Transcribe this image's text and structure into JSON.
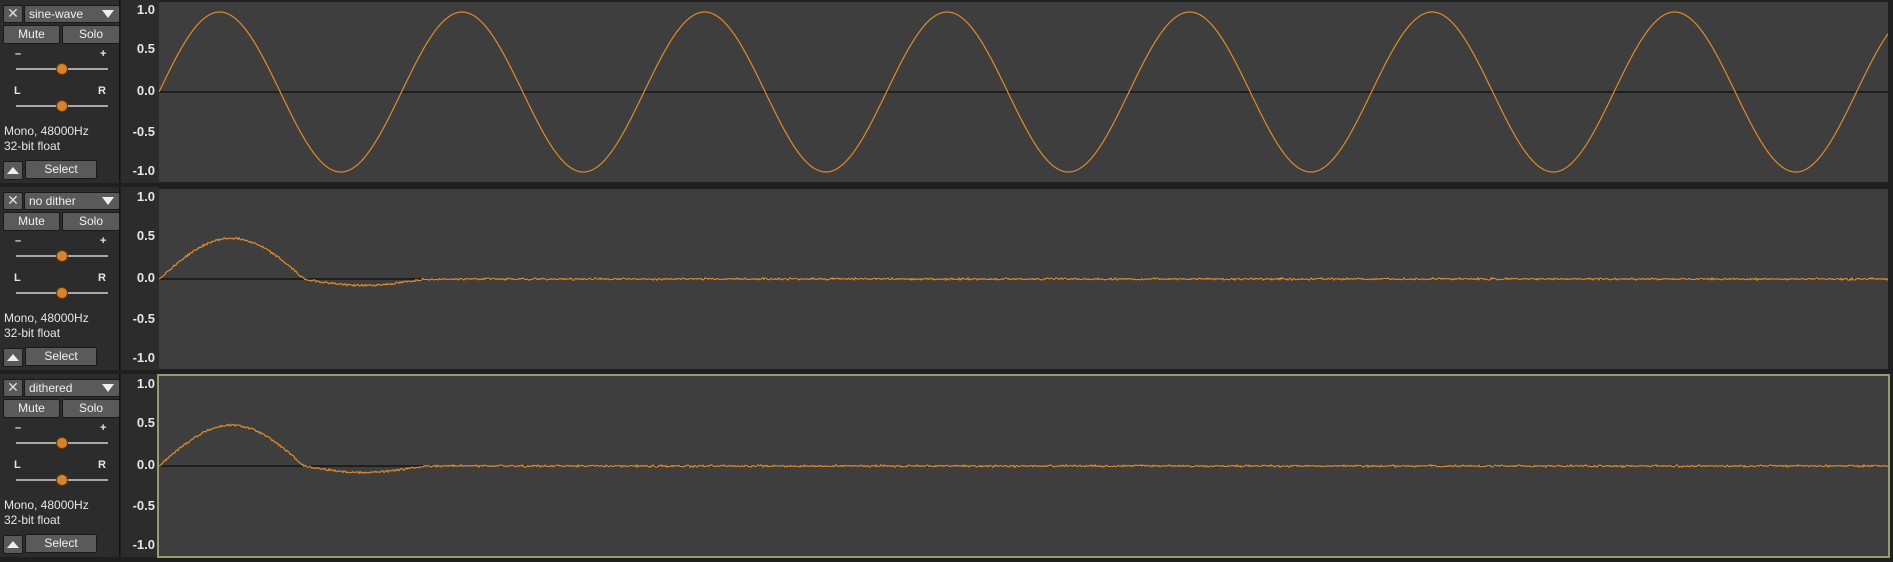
{
  "tracks": [
    {
      "name": "sine-wave",
      "close_glyph": "✕",
      "mute_label": "Mute",
      "solo_label": "Solo",
      "gain_minus": "–",
      "gain_plus": "+",
      "pan_left": "L",
      "pan_right": "R",
      "info_line1": "Mono, 48000Hz",
      "info_line2": "32-bit float",
      "select_label": "Select",
      "gain_value": 0.5,
      "pan_value": 0.5,
      "ruler_labels": [
        "1.0",
        "0.5",
        "0.0",
        "-0.5",
        "-1.0"
      ],
      "waveform": "sine",
      "selected": false
    },
    {
      "name": "no dither",
      "close_glyph": "✕",
      "mute_label": "Mute",
      "solo_label": "Solo",
      "gain_minus": "–",
      "gain_plus": "+",
      "pan_left": "L",
      "pan_right": "R",
      "info_line1": "Mono, 48000Hz",
      "info_line2": "32-bit float",
      "select_label": "Select",
      "gain_value": 0.5,
      "pan_value": 0.5,
      "ruler_labels": [
        "1.0",
        "0.5",
        "0.0",
        "-0.5",
        "-1.0"
      ],
      "waveform": "pulse-decay-noise",
      "selected": false
    },
    {
      "name": "dithered",
      "close_glyph": "✕",
      "mute_label": "Mute",
      "solo_label": "Solo",
      "gain_minus": "–",
      "gain_plus": "+",
      "pan_left": "L",
      "pan_right": "R",
      "info_line1": "Mono, 48000Hz",
      "info_line2": "32-bit float",
      "select_label": "Select",
      "gain_value": 0.5,
      "pan_value": 0.5,
      "ruler_labels": [
        "1.0",
        "0.5",
        "0.0",
        "-0.5",
        "-1.0"
      ],
      "waveform": "pulse-decay-noise",
      "selected": true
    }
  ],
  "colors": {
    "waveform": "#e08a2a",
    "zero_line": "#000000",
    "wave_background": "#3e3e3e",
    "panel_background": "#2c2c2c",
    "selected_outline": "#9a9a6e"
  },
  "icons": {
    "close": "close-icon",
    "dropdown": "chevron-down-icon",
    "collapse": "chevron-up-icon"
  }
}
